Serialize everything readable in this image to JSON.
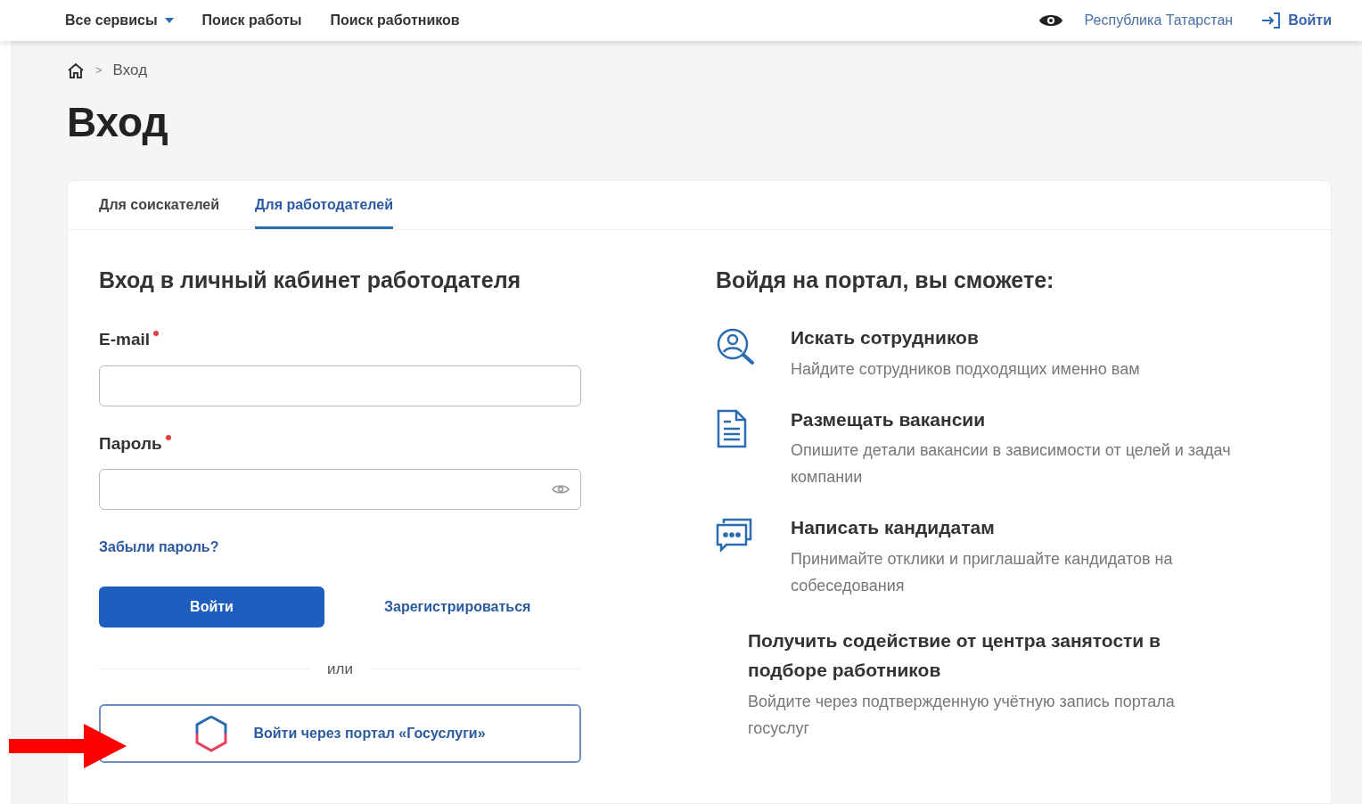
{
  "header": {
    "nav": [
      {
        "label": "Все сервисы",
        "kind": "dropdown"
      },
      {
        "label": "Поиск работы",
        "kind": "link"
      },
      {
        "label": "Поиск работников",
        "kind": "link"
      }
    ],
    "region": "Республика Татарстан",
    "login": "Войти"
  },
  "breadcrumb": {
    "separator": ">",
    "items": [
      "Вход"
    ]
  },
  "title": "Вход",
  "tabs": [
    {
      "label": "Для соискателей",
      "selected": false
    },
    {
      "label": "Для работодателей",
      "selected": true
    }
  ],
  "form": {
    "heading": "Вход в личный кабинет работодателя",
    "fields": [
      {
        "label": "E-mail",
        "required": true,
        "kind": "text"
      },
      {
        "label": "Пароль",
        "required": true,
        "kind": "password"
      }
    ],
    "forgot": "Забыли пароль?",
    "submit": "Войти",
    "register": "Зарегистрироваться",
    "divider": "или",
    "gosuslugi": "Войти через портал «Госуслуги»"
  },
  "benefits": {
    "heading": "Войдя на портал, вы сможете:",
    "items": [
      {
        "kind": "search",
        "title": "Искать сотрудников",
        "text": "Найдите сотрудников подходящих именно вам"
      },
      {
        "kind": "document",
        "title": "Размещать вакансии",
        "text": "Опишите детали вакансии в зависимости от целей и задач компании"
      },
      {
        "kind": "chat",
        "title": "Написать кандидатам",
        "text": "Принимайте отклики и приглашайте кандидатов на собеседования"
      }
    ],
    "extra_title": "Получить содействие от центра занятости в подборе работников",
    "extra_text": "Войдите через подтвержденную учётную запись портала госуслуг"
  }
}
